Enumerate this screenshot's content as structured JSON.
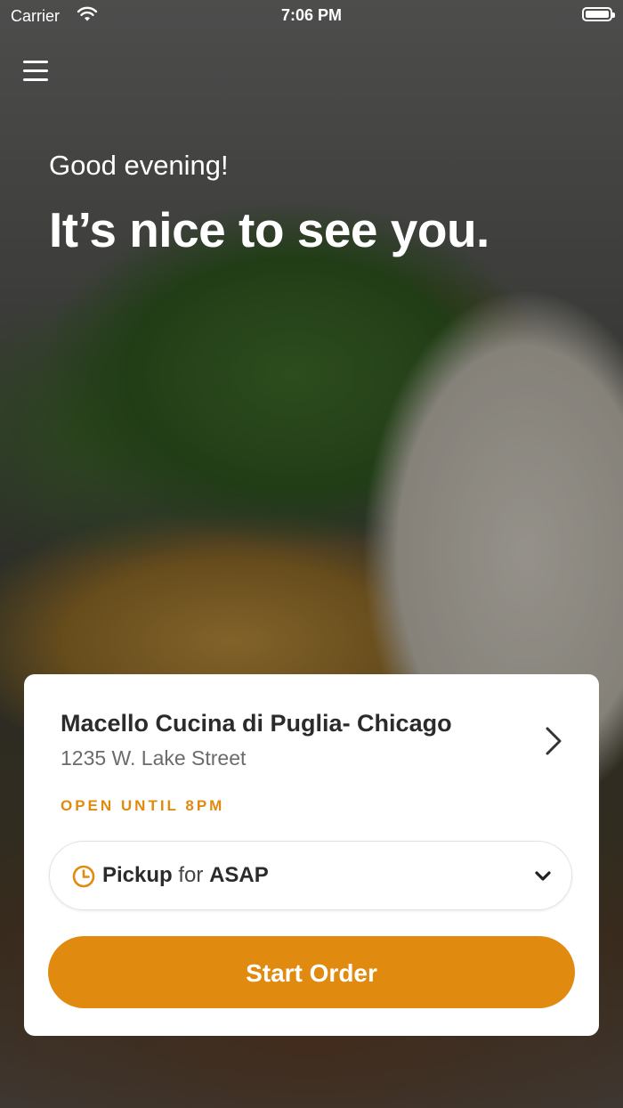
{
  "status_bar": {
    "carrier": "Carrier",
    "time": "7:06 PM"
  },
  "menu": {
    "icon": "hamburger-menu-icon"
  },
  "hero": {
    "greeting": "Good evening!",
    "headline": "It’s nice to see you."
  },
  "store": {
    "name": "Macello Cucina di Puglia- Chicago",
    "address": "1235 W. Lake Street",
    "open_status": "OPEN UNTIL 8PM"
  },
  "order_mode": {
    "mode": "Pickup",
    "connector": "for",
    "time": "ASAP"
  },
  "start_button": {
    "label": "Start Order"
  },
  "colors": {
    "accent": "#e08a0f",
    "card_background": "#ffffff",
    "text_primary": "#2b2b2b",
    "text_secondary": "#6b6b6b"
  }
}
